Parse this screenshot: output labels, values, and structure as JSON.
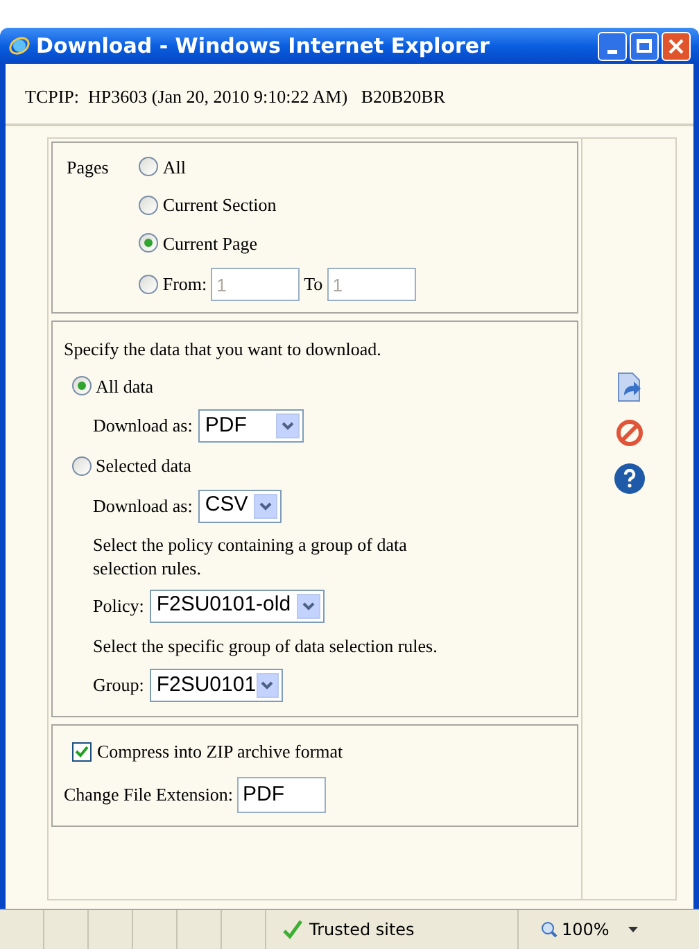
{
  "window": {
    "title": "Download - Windows Internet Explorer"
  },
  "header": "TCPIP:  HP3603 (Jan 20, 2010 9:10:22 AM)   B20B20BR",
  "pages": {
    "label": "Pages",
    "options": [
      {
        "label": "All",
        "selected": false
      },
      {
        "label": "Current Section",
        "selected": false
      },
      {
        "label": "Current Page",
        "selected": true
      },
      {
        "label": "From:",
        "selected": false
      }
    ],
    "from": {
      "value": "1"
    },
    "to_label": "To",
    "to": {
      "value": "1"
    }
  },
  "data": {
    "intro": "Specify the data that you want to download.",
    "all": {
      "label": "All data",
      "selected": true,
      "download_label": "Download as:",
      "format": "PDF"
    },
    "selected_data": {
      "label": "Selected data",
      "selected": false,
      "download_label": "Download as:",
      "format": "CSV",
      "policy_hint": "Select the policy containing a group of data selection rules.",
      "policy_label": "Policy:",
      "policy": "F2SU0101-old",
      "group_hint": "Select the specific group of data selection rules.",
      "group_label": "Group:",
      "group": "F2SU0101"
    }
  },
  "compress": {
    "label": "Compress into ZIP archive format",
    "checked": true,
    "extension_label": "Change File Extension:",
    "extension": "PDF"
  },
  "status_bar": {
    "zone": "Trusted sites",
    "zoom": "100%"
  }
}
